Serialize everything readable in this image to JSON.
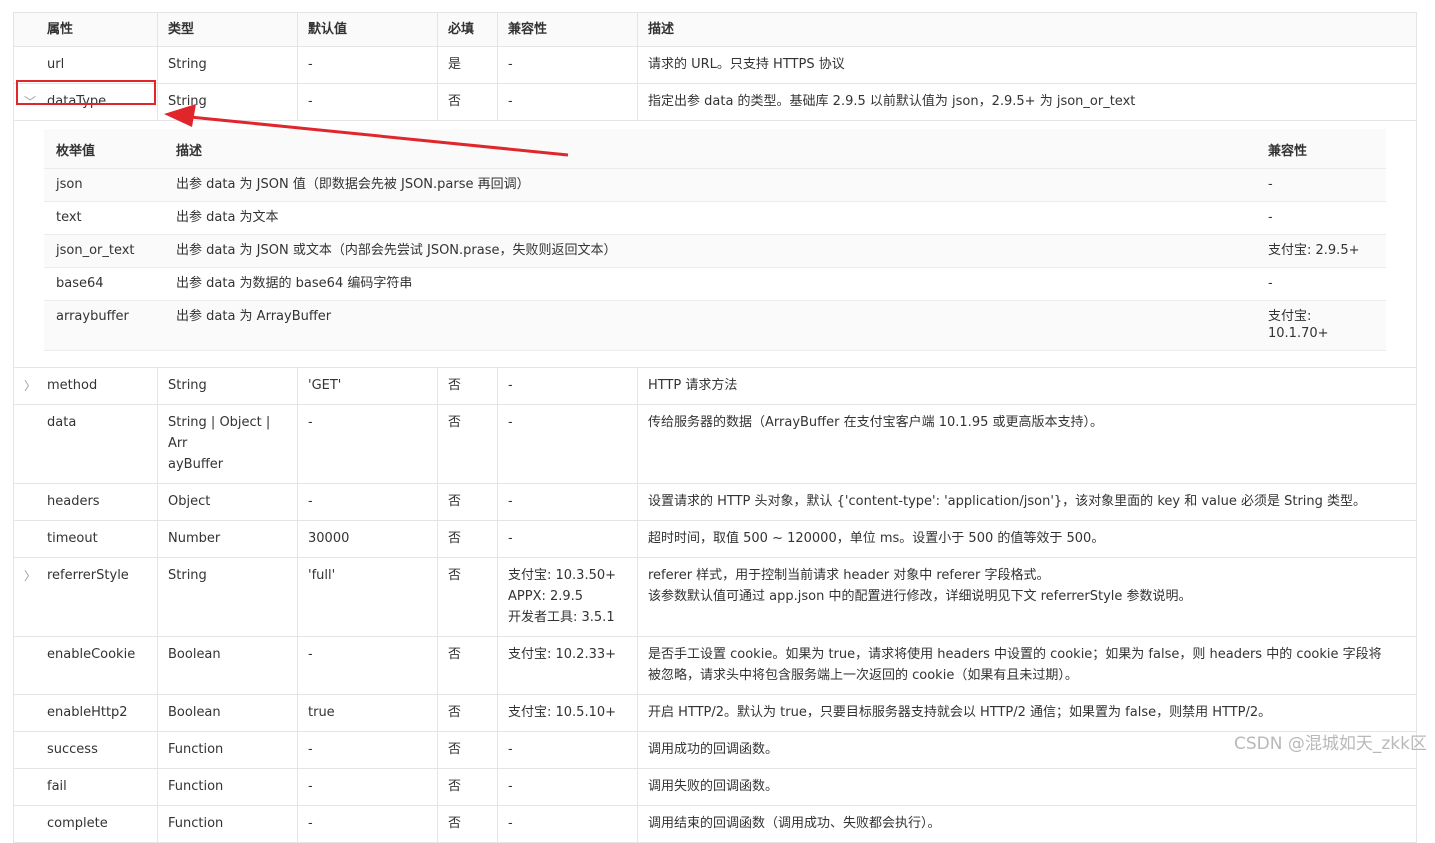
{
  "header": [
    "属性",
    "类型",
    "默认值",
    "必填",
    "兼容性",
    "描述"
  ],
  "rows": {
    "url": {
      "name": "url",
      "type": "String",
      "default": "-",
      "required": "是",
      "compat": "-",
      "desc": "请求的 URL。只支持 HTTPS 协议"
    },
    "dataType": {
      "name": "dataType",
      "type": "String",
      "default": "-",
      "required": "否",
      "compat": "-",
      "desc": "指定出参 data 的类型。基础库 2.9.5 以前默认值为 json，2.9.5+ 为 json_or_text"
    },
    "method": {
      "name": "method",
      "type": "String",
      "default": "'GET'",
      "required": "否",
      "compat": "-",
      "desc": "HTTP 请求方法"
    },
    "data": {
      "name": "data",
      "type1": "String | Object | Arr",
      "type2": "ayBuffer",
      "default": "-",
      "required": "否",
      "compat": "-",
      "desc": "传给服务器的数据（ArrayBuffer 在支付宝客户端 10.1.95 或更高版本支持）。"
    },
    "headers": {
      "name": "headers",
      "type": "Object",
      "default": "-",
      "required": "否",
      "compat": "-",
      "desc": "设置请求的 HTTP 头对象，默认 {'content-type': 'application/json'}，该对象里面的 key 和 value 必须是 String 类型。"
    },
    "timeout": {
      "name": "timeout",
      "type": "Number",
      "default": "30000",
      "required": "否",
      "compat": "-",
      "desc": "超时时间，取值 500 ~ 120000，单位 ms。设置小于 500 的值等效于 500。"
    },
    "referrerStyle": {
      "name": "referrerStyle",
      "type": "String",
      "default": "'full'",
      "required": "否",
      "compat1": "支付宝: 10.3.50+",
      "compat2": "APPX: 2.9.5",
      "compat3": "开发者工具: 3.5.1",
      "desc1": "referer 样式，用于控制当前请求 header 对象中 referer 字段格式。",
      "desc2": "该参数默认值可通过 app.json 中的配置进行修改，详细说明见下文 referrerStyle 参数说明。"
    },
    "enableCookie": {
      "name": "enableCookie",
      "type": "Boolean",
      "default": "-",
      "required": "否",
      "compat": "支付宝: 10.2.33+",
      "desc1": "是否手工设置 cookie。如果为 true，请求将使用 headers 中设置的 cookie；如果为 false，则 headers 中的 cookie 字段将",
      "desc2": "被忽略，请求头中将包含服务端上一次返回的 cookie（如果有且未过期）。"
    },
    "enableHttp2": {
      "name": "enableHttp2",
      "type": "Boolean",
      "default": "true",
      "required": "否",
      "compat": "支付宝: 10.5.10+",
      "desc": "开启 HTTP/2。默认为 true，只要目标服务器支持就会以 HTTP/2 通信；如果置为 false，则禁用 HTTP/2。"
    },
    "success": {
      "name": "success",
      "type": "Function",
      "default": "-",
      "required": "否",
      "compat": "-",
      "desc": "调用成功的回调函数。"
    },
    "fail": {
      "name": "fail",
      "type": "Function",
      "default": "-",
      "required": "否",
      "compat": "-",
      "desc": "调用失败的回调函数。"
    },
    "complete": {
      "name": "complete",
      "type": "Function",
      "default": "-",
      "required": "否",
      "compat": "-",
      "desc": "调用结束的回调函数（调用成功、失败都会执行）。"
    }
  },
  "enum": {
    "header": [
      "枚举值",
      "描述",
      "兼容性"
    ],
    "rows": [
      {
        "value": "json",
        "desc": "出参 data 为 JSON 值（即数据会先被 JSON.parse 再回调）",
        "compat": "-"
      },
      {
        "value": "text",
        "desc": "出参 data 为文本",
        "compat": "-"
      },
      {
        "value": "json_or_text",
        "desc": "出参 data 为 JSON 或文本（内部会先尝试 JSON.prase，失败则返回文本）",
        "compat": "支付宝: 2.9.5+"
      },
      {
        "value": "base64",
        "desc": "出参 data 为数据的 base64 编码字符串",
        "compat": "-"
      },
      {
        "value": "arraybuffer",
        "desc": "出参 data 为 ArrayBuffer",
        "compat": "支付宝: 10.1.70+"
      }
    ]
  },
  "icons": {
    "expanded": "chevron-down-icon",
    "collapsed": "chevron-right-icon"
  },
  "colors": {
    "border": "#e4e4e4",
    "header_bg": "#fafafa",
    "annotation": "#e0252b"
  },
  "watermark": "CSDN @混城如天_zkk区"
}
